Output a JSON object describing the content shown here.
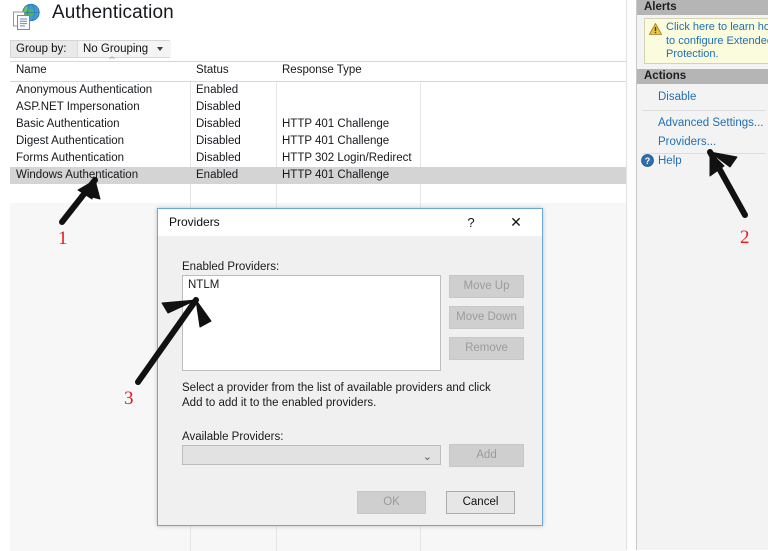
{
  "header": {
    "title": "Authentication",
    "icon": "globe-page-icon"
  },
  "groupby": {
    "label": "Group by:",
    "value": "No Grouping",
    "caret_icon": "chevron-down-icon"
  },
  "grid": {
    "columns": [
      "Name",
      "Status",
      "Response Type"
    ],
    "sort_indicator": "^",
    "rows": [
      {
        "name": "Anonymous Authentication",
        "status": "Enabled",
        "response": ""
      },
      {
        "name": "ASP.NET Impersonation",
        "status": "Disabled",
        "response": ""
      },
      {
        "name": "Basic Authentication",
        "status": "Disabled",
        "response": "HTTP 401 Challenge"
      },
      {
        "name": "Digest Authentication",
        "status": "Disabled",
        "response": "HTTP 401 Challenge"
      },
      {
        "name": "Forms Authentication",
        "status": "Disabled",
        "response": "HTTP 302 Login/Redirect"
      },
      {
        "name": "Windows Authentication",
        "status": "Enabled",
        "response": "HTTP 401 Challenge"
      }
    ],
    "selected_row_index": 5
  },
  "right_panel": {
    "alerts": {
      "header": "Alerts",
      "icon": "warning-triangle-icon",
      "text": "Click here to learn how to configure Extended Protection."
    },
    "actions": {
      "header": "Actions",
      "items": [
        {
          "label": "Disable",
          "icon": ""
        },
        {
          "label": "Advanced Settings...",
          "icon": ""
        },
        {
          "label": "Providers...",
          "icon": ""
        },
        {
          "label": "Help",
          "icon": "help-icon"
        }
      ]
    }
  },
  "dialog": {
    "title": "Providers",
    "help_button": "?",
    "close_button": "✕",
    "enabled_label": "Enabled Providers:",
    "enabled_items": [
      "NTLM"
    ],
    "buttons": {
      "move_up": "Move Up",
      "move_down": "Move Down",
      "remove": "Remove",
      "add": "Add",
      "ok": "OK",
      "cancel": "Cancel"
    },
    "hint": "Select a provider from the list of available providers and click Add to add it to the enabled providers.",
    "available_label": "Available Providers:",
    "available_value": "",
    "combo_caret_icon": "chevron-down-icon"
  },
  "annotations": {
    "color": "#e8191c",
    "marks": [
      {
        "number": "1",
        "target": "windows-authentication-row"
      },
      {
        "number": "2",
        "target": "providers-action-link"
      },
      {
        "number": "3",
        "target": "enabled-providers-listbox"
      }
    ]
  }
}
